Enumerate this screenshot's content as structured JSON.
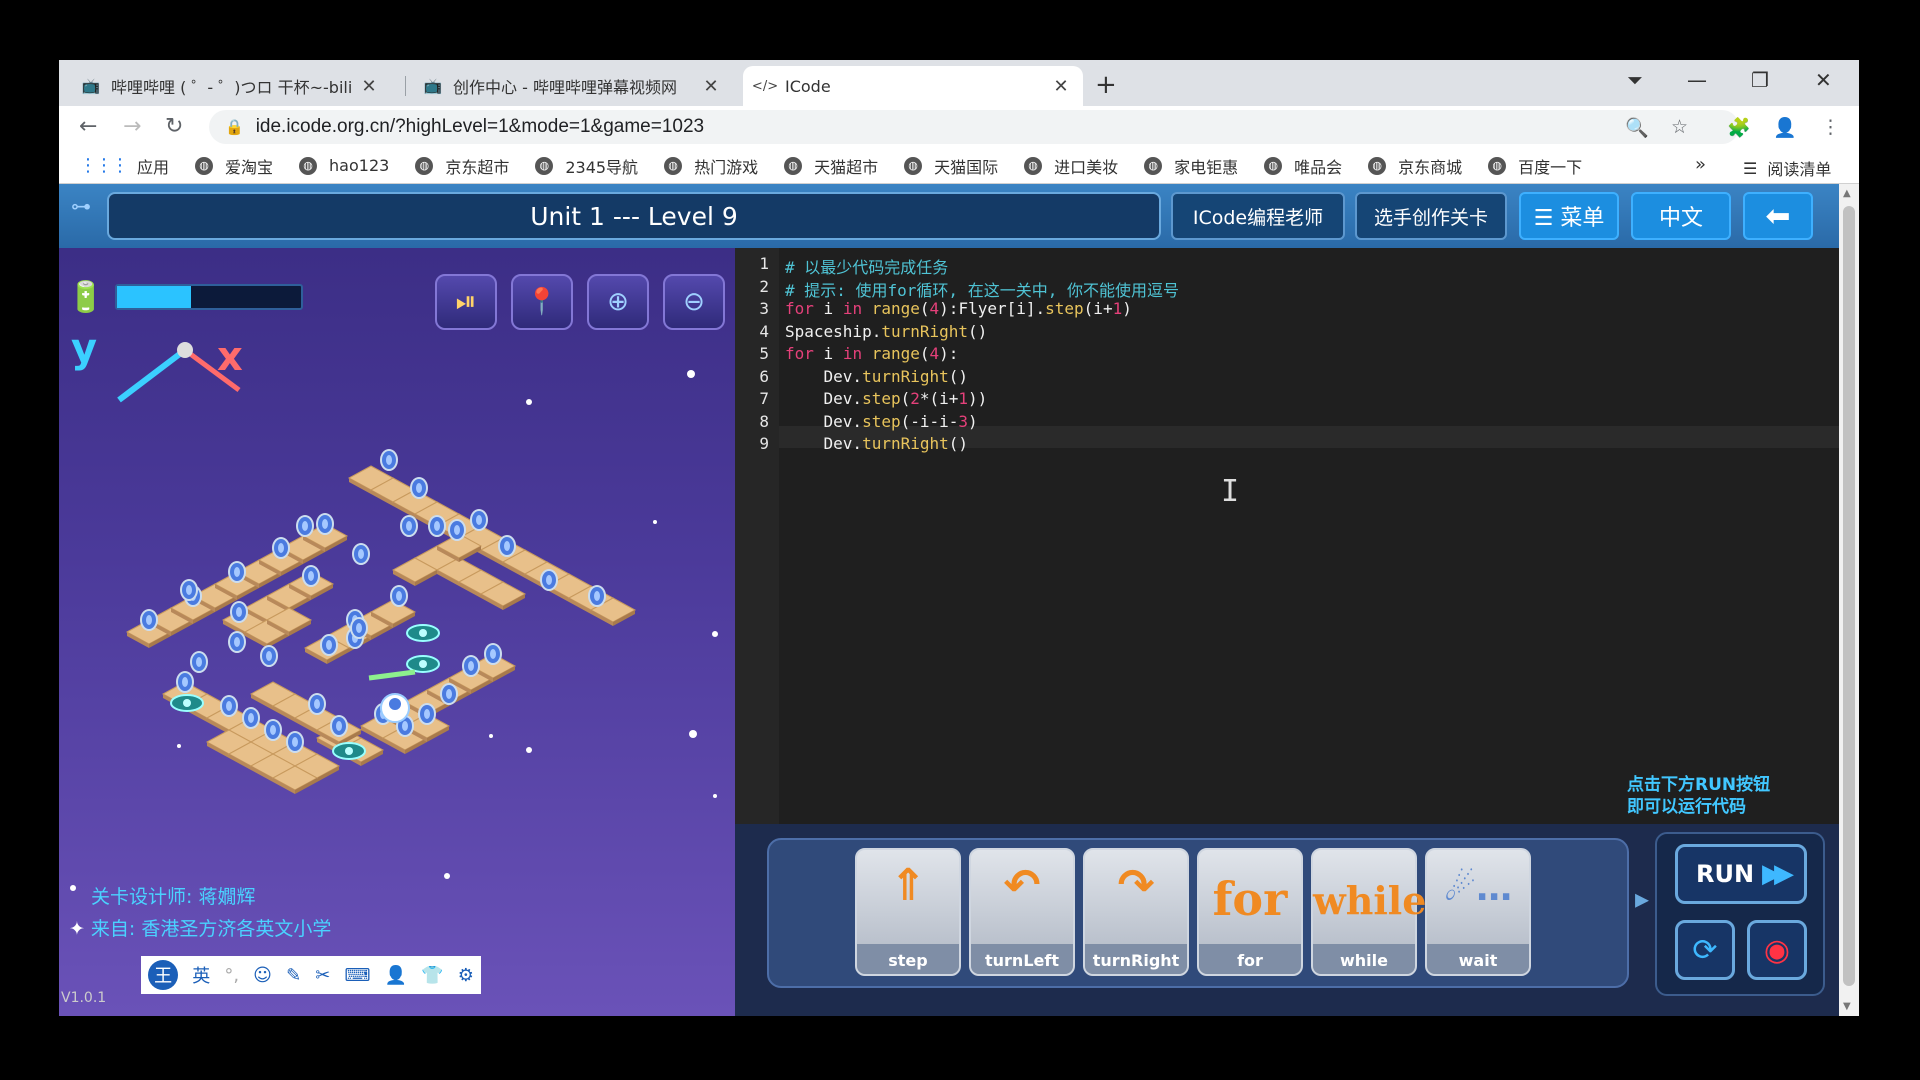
{
  "browser": {
    "tabs": [
      {
        "title": "哔哩哔哩 ( ゜- ゜)つロ 干杯~-bili",
        "icon": "bilibili-icon"
      },
      {
        "title": "创作中心 - 哔哩哔哩弹幕视频网",
        "icon": "bilibili-icon"
      },
      {
        "title": "ICode",
        "icon": "code-icon"
      }
    ],
    "url": "ide.icode.org.cn/?highLevel=1&mode=1&game=1023",
    "bookmarks": [
      "应用",
      "爱淘宝",
      "hao123",
      "京东超市",
      "2345导航",
      "热门游戏",
      "天猫超市",
      "天猫国际",
      "进口美妆",
      "家电钜惠",
      "唯品会",
      "京东商城",
      "百度一下"
    ],
    "bookmarks_more": "»",
    "reading_list": "阅读清单"
  },
  "header": {
    "title": "Unit 1 --- Level 9",
    "teacher_btn": "ICode编程老师",
    "create_btn": "选手创作关卡",
    "menu_btn": "☰ 菜单",
    "lang_btn": "中文",
    "back_btn": "⬅"
  },
  "game": {
    "energy_fraction": 0.4,
    "axis_y": "y",
    "axis_x": "x",
    "designer": "关卡设计师: 蒋嫺辉",
    "source": "来自: 香港圣方济各英文小学",
    "version": "V1.0.1",
    "ime": [
      "王",
      "英",
      "°,",
      "☺",
      "✎",
      "✂",
      "⌨",
      "👤",
      "👕",
      "⚙"
    ]
  },
  "editor": {
    "line_numbers": [
      "1",
      "2",
      "3",
      "4",
      "5",
      "6",
      "7",
      "8",
      "9"
    ],
    "lines": [
      "# 以最少代码完成任务",
      "# 提示: 使用for循环, 在这一关中, 你不能使用逗号",
      "for i in range(4):Flyer[i].step(i+1)",
      "Spaceship.turnRight()",
      "for i in range(4):",
      "    Dev.turnRight()",
      "    Dev.step(2*(i+1))",
      "    Dev.step(-i-i-3)",
      "    Dev.turnRight()"
    ]
  },
  "hint": {
    "line1": "点击下方RUN按钮",
    "line2": "即可以运行代码"
  },
  "blocks": [
    {
      "label": "step",
      "icon": "step-icon"
    },
    {
      "label": "turnLeft",
      "icon": "turn-left-icon"
    },
    {
      "label": "turnRight",
      "icon": "turn-right-icon"
    },
    {
      "label": "for",
      "word": "for"
    },
    {
      "label": "while",
      "word": "while"
    },
    {
      "label": "wait",
      "icon": "robot-wait-icon"
    }
  ],
  "run": {
    "label": "RUN"
  },
  "colors": {
    "accent": "#1c8ee0",
    "game_bg": "#4b3a9a",
    "tile": "#e8c08a"
  }
}
